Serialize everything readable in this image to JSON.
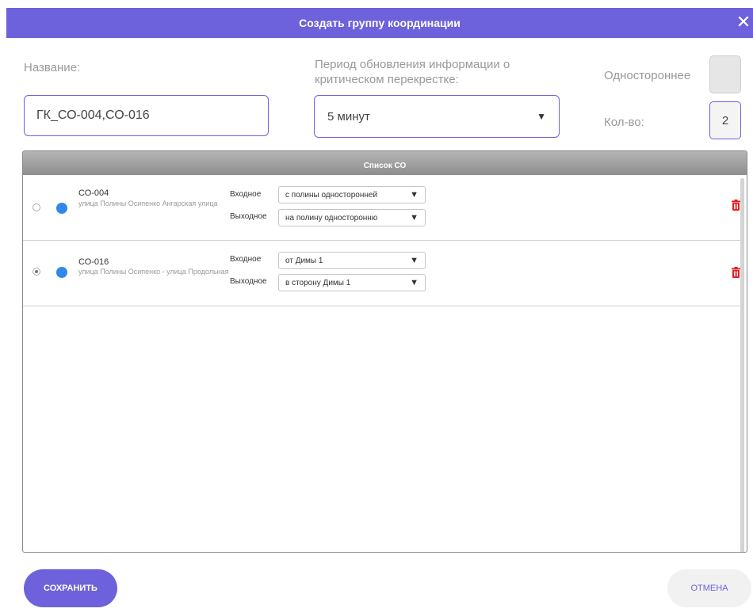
{
  "dialog": {
    "title": "Создать группу координации",
    "close_icon": "close-icon"
  },
  "form": {
    "name_label": "Название:",
    "name_value": "ГК_СО-004,СО-016",
    "period_label": "Период обновления информации о критическом перекрестке:",
    "period_value": "5 минут",
    "oneway_label": "Одностороннее",
    "oneway_checked": false,
    "count_label": "Кол-во:",
    "count_value": "2"
  },
  "list": {
    "header": "Список СО",
    "rows": [
      {
        "id": "СО-004",
        "address": "улица Полины Осипенко Ангарская улица",
        "selected": false,
        "status_color": "#3187ea",
        "input_label": "Входное",
        "input_value": "с полины односторонней",
        "output_label": "Выходное",
        "output_value": "на полину односторонню"
      },
      {
        "id": "СО-016",
        "address": "улица Полины Осипенко - улица Продольная",
        "selected": true,
        "status_color": "#3187ea",
        "input_label": "Входное",
        "input_value": "от Димы 1",
        "output_label": "Выходное",
        "output_value": "в сторону Димы 1"
      }
    ]
  },
  "buttons": {
    "save": "СОХРАНИТЬ",
    "cancel": "ОТМЕНА"
  },
  "colors": {
    "accent": "#6d62db",
    "delete": "#e02020",
    "status": "#3187ea"
  }
}
